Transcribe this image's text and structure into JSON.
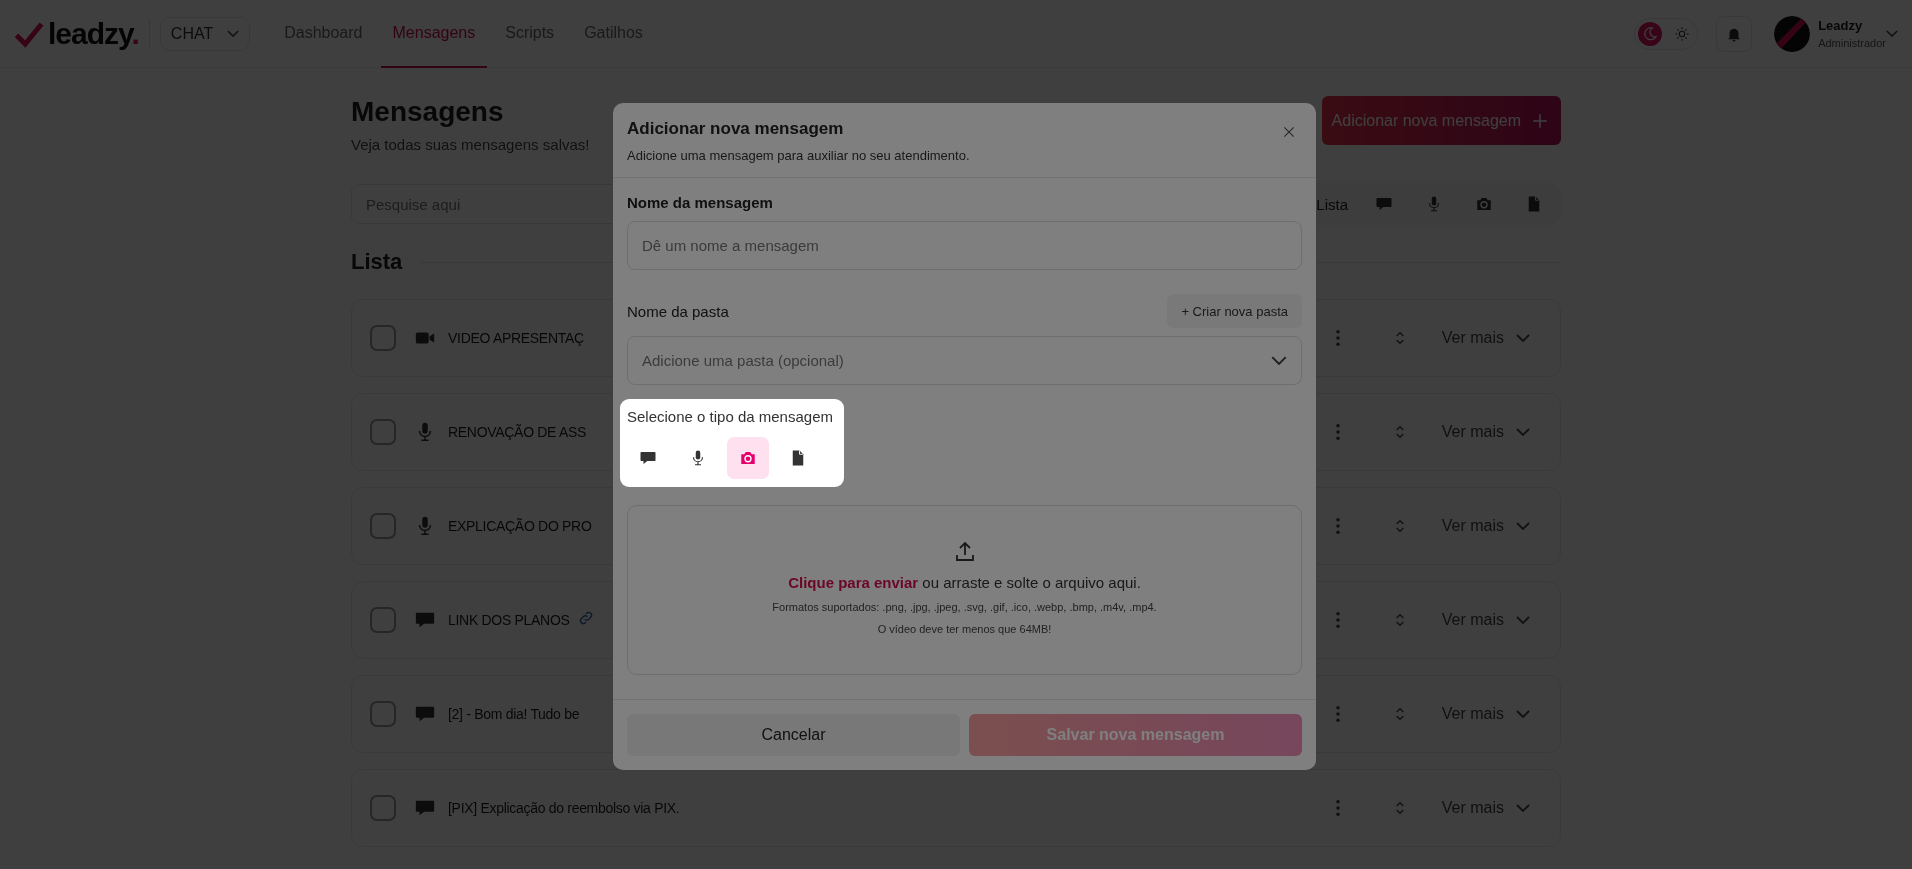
{
  "header": {
    "logo": {
      "text": "leadzy",
      "dot": "."
    },
    "workspace_select": "CHAT",
    "nav": [
      {
        "label": "Dashboard",
        "selected": false
      },
      {
        "label": "Mensagens",
        "selected": true
      },
      {
        "label": "Scripts",
        "selected": false
      },
      {
        "label": "Gatilhos",
        "selected": false
      }
    ],
    "theme_toggle": [
      {
        "kind": "moon",
        "selected": true
      },
      {
        "kind": "sun",
        "selected": false
      }
    ],
    "user": {
      "name": "Leadzy",
      "role": "Administrador"
    }
  },
  "page": {
    "title": "Mensagens",
    "subtitle": "Veja todas suas mensagens salvas!",
    "add_button": "Adicionar nova mensagem",
    "search": {
      "placeholder": "Pesquise aqui"
    },
    "filters": [
      {
        "kind": "text",
        "label": "Lista"
      },
      {
        "kind": "chat"
      },
      {
        "kind": "mic"
      },
      {
        "kind": "camera"
      },
      {
        "kind": "file"
      }
    ],
    "list_title": "Lista",
    "messages": [
      {
        "kind": "video",
        "title": "VIDEO APRESENTAÇ",
        "link": false,
        "checked": false,
        "more": "Ver mais"
      },
      {
        "kind": "mic",
        "title": "RENOVAÇÃO DE ASS",
        "link": false,
        "checked": false,
        "more": "Ver mais"
      },
      {
        "kind": "mic",
        "title": "EXPLICAÇÃO DO PRO",
        "link": false,
        "checked": false,
        "more": "Ver mais"
      },
      {
        "kind": "chat",
        "title": "LINK DOS PLANOS",
        "link": true,
        "checked": false,
        "more": "Ver mais"
      },
      {
        "kind": "chat",
        "title": "[2] - Bom dia! Tudo be",
        "link": false,
        "checked": false,
        "more": "Ver mais"
      },
      {
        "kind": "chat",
        "title": "[PIX] Explicação do reembolso via PIX.",
        "link": false,
        "checked": false,
        "more": "Ver mais"
      }
    ]
  },
  "modal": {
    "title": "Adicionar nova mensagem",
    "subtitle": "Adicione uma mensagem para auxiliar no seu atendimento.",
    "name_label": "Nome da mensagem",
    "name_field": {
      "placeholder": "Dê um nome a mensagem"
    },
    "folder_label": "Nome da pasta",
    "create_folder_button": "+ Criar nova pasta",
    "folder_select": {
      "placeholder": "Adicione uma pasta (opcional)"
    },
    "type_label": "Selecione o tipo da mensagem",
    "types": [
      {
        "kind": "chat",
        "selected": false
      },
      {
        "kind": "mic",
        "selected": false
      },
      {
        "kind": "camera",
        "selected": true
      },
      {
        "kind": "file",
        "selected": false
      }
    ],
    "upload": {
      "link": "Clique para enviar",
      "text": " ou arraste e solte o arquivo aqui.",
      "formats": "Formatos suportados: .png, .jpg, .jpeg, .svg, .gif, .ico, .webp, .bmp, .m4v, .mp4.",
      "limit": "O vídeo deve ter menos que 64MB!"
    },
    "cancel_button": "Cancelar",
    "save_button": {
      "label": "Salvar nova mensagem",
      "disabled": true
    }
  }
}
